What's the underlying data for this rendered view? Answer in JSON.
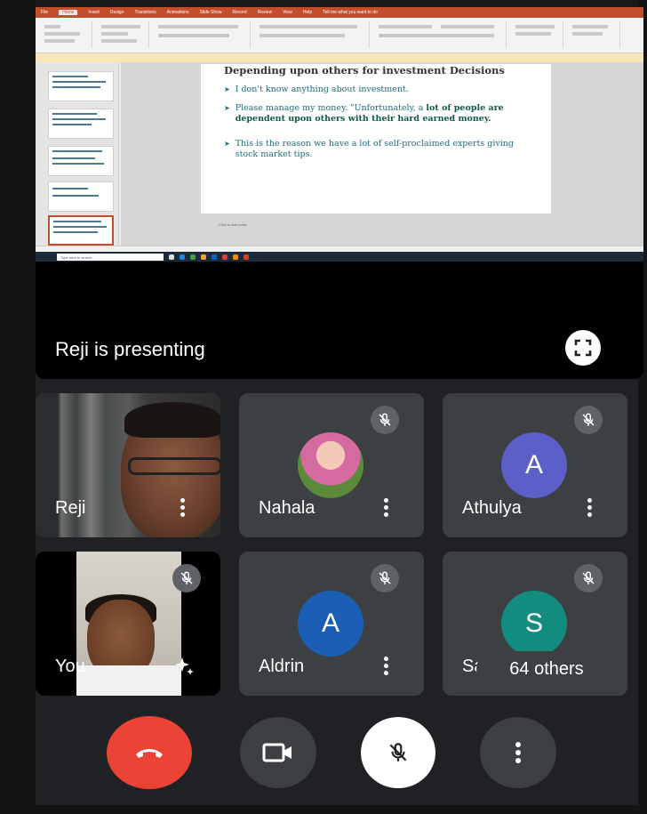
{
  "presentation": {
    "presenter_label": "Reji is presenting",
    "ribbon_tabs": [
      "File",
      "Home",
      "Insert",
      "Design",
      "Transitions",
      "Animations",
      "Slide Show",
      "Record",
      "Review",
      "View",
      "Help",
      "Tell me what you want to do"
    ],
    "slide": {
      "title": "Depending upon others for investment Decisions",
      "bullets": [
        {
          "text": "I don't know anything about investment.",
          "bold": ""
        },
        {
          "text": "Please manage my money. \"Unfortunately, a ",
          "bold": "lot of people are dependent upon others with their hard earned money."
        },
        {
          "text": "This is the reason we have a lot of self-proclaimed experts giving stock market tips.",
          "bold": ""
        }
      ],
      "notes_placeholder": "Click to add notes"
    },
    "taskbar_search": "Type here to search"
  },
  "participants": [
    {
      "name": "Reji",
      "type": "video",
      "muted": false
    },
    {
      "name": "Nahala",
      "type": "photo",
      "muted": true
    },
    {
      "name": "Athulya",
      "type": "initial",
      "initial": "A",
      "color": "#5b5fc7",
      "muted": true
    },
    {
      "name": "You",
      "type": "video",
      "muted": true
    },
    {
      "name": "Aldrin",
      "type": "initial",
      "initial": "A",
      "color": "#1a5fb4",
      "muted": true
    },
    {
      "name": "Sa",
      "type": "initial",
      "initial": "S",
      "color": "#128c7e",
      "muted": true
    }
  ],
  "others_label": "64 others",
  "controls": {
    "end_call_color": "#ea4335",
    "camera_on": true,
    "mic_muted": true
  }
}
